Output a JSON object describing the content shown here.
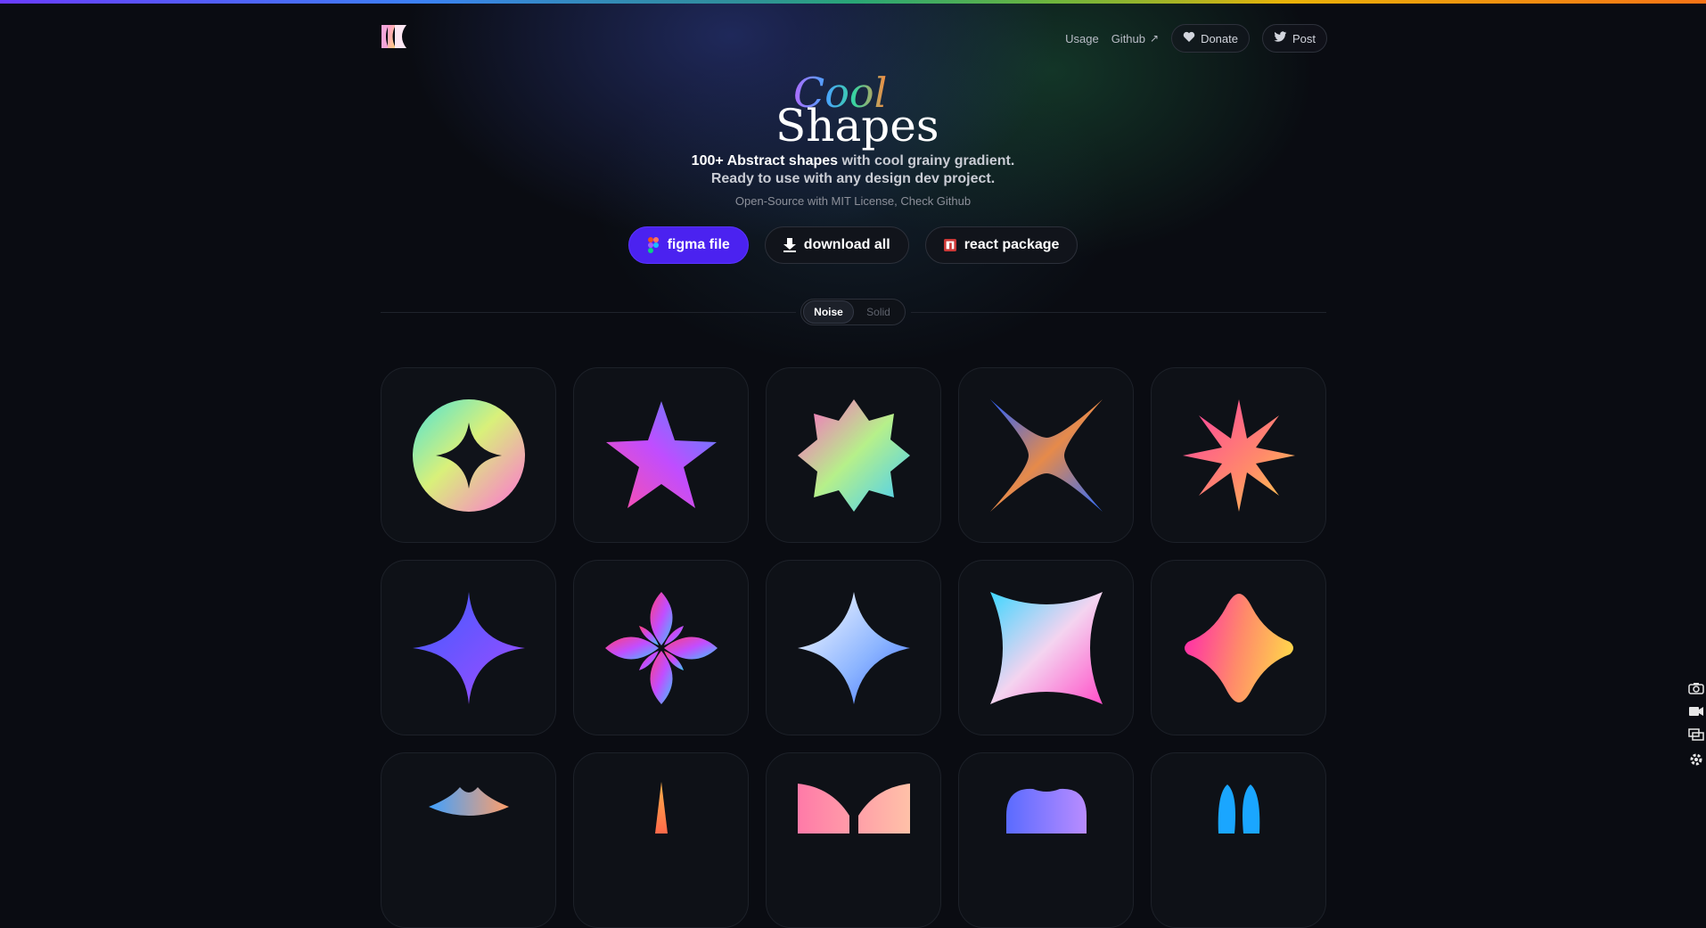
{
  "nav": {
    "usage": "Usage",
    "github": "Github",
    "github_arrow": "↗",
    "donate": "Donate",
    "post": "Post"
  },
  "hero": {
    "script_word": "Cool",
    "title_word": "Shapes",
    "sub_strong": "100+ Abstract shapes",
    "sub_rest": " with cool grainy gradient.",
    "sub_line2": "Ready to use with any design dev project.",
    "license": "Open-Source with MIT License, Check Github"
  },
  "actions": {
    "figma": "figma file",
    "download": "download all",
    "react": "react package"
  },
  "toggle": {
    "noise": "Noise",
    "solid": "Solid"
  },
  "icons": {
    "logo": "cool-shapes-logo-icon",
    "heart": "heart-icon",
    "twitter": "twitter-bird-icon",
    "figma": "figma-icon",
    "download": "download-arrow-icon",
    "npm": "npm-icon"
  },
  "colors": {
    "primary_button": "#4b22f0",
    "background": "#0a0c12"
  }
}
